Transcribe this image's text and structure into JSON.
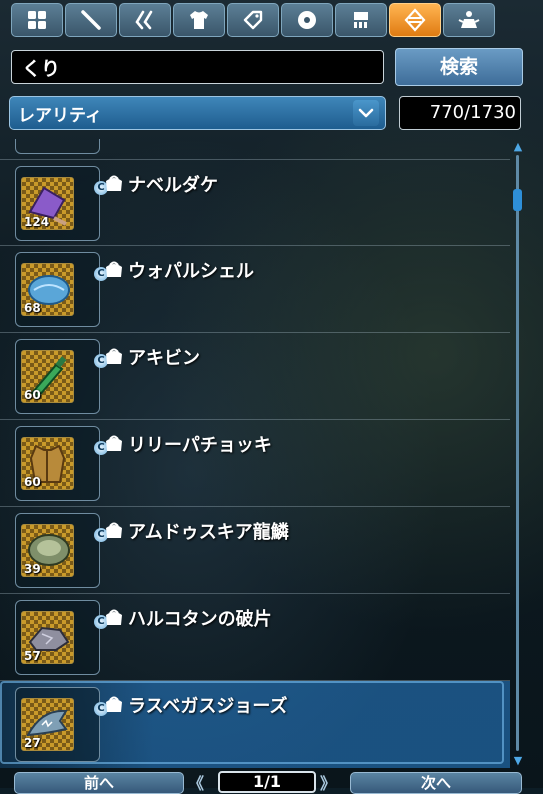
{
  "tabs": [
    {
      "icon": "grid-icon",
      "active": false
    },
    {
      "icon": "sword-icon",
      "active": false
    },
    {
      "icon": "double-claw-icon",
      "active": false
    },
    {
      "icon": "shirt-icon",
      "active": false
    },
    {
      "icon": "tag-icon",
      "active": false
    },
    {
      "icon": "disc-icon",
      "active": false
    },
    {
      "icon": "room-icon",
      "active": false
    },
    {
      "icon": "exchange-icon",
      "active": true
    },
    {
      "icon": "mag-icon",
      "active": false
    }
  ],
  "search": {
    "value": "くり",
    "button_label": "検索"
  },
  "sort": {
    "label": "レアリティ"
  },
  "count": "770/1730",
  "items": [
    {
      "name": "ナベルダケ",
      "qty": "124",
      "badge": "C",
      "thumb_color": "#8a5bc9",
      "icon": "purple-mushroom-icon"
    },
    {
      "name": "ウォパルシェル",
      "qty": "68",
      "badge": "C",
      "thumb_color": "#5aa6d8",
      "icon": "blue-shell-icon"
    },
    {
      "name": "アキビン",
      "qty": "60",
      "badge": "C",
      "thumb_color": "#3aa85a",
      "icon": "green-bottle-icon"
    },
    {
      "name": "リリーパチョッキ",
      "qty": "60",
      "badge": "C",
      "thumb_color": "#b88a3a",
      "icon": "vest-icon"
    },
    {
      "name": "アムドゥスキア龍鱗",
      "qty": "39",
      "badge": "C",
      "thumb_color": "#7f8f6a",
      "icon": "dragon-scale-icon"
    },
    {
      "name": "ハルコタンの破片",
      "qty": "57",
      "badge": "C",
      "thumb_color": "#8f8f9f",
      "icon": "fragment-icon"
    },
    {
      "name": "ラスベガスジョーズ",
      "qty": "27",
      "badge": "C",
      "thumb_color": "#7f9fb5",
      "icon": "shark-icon"
    }
  ],
  "pager": {
    "prev_label": "前へ",
    "page": "1/1",
    "next_label": "次へ"
  }
}
